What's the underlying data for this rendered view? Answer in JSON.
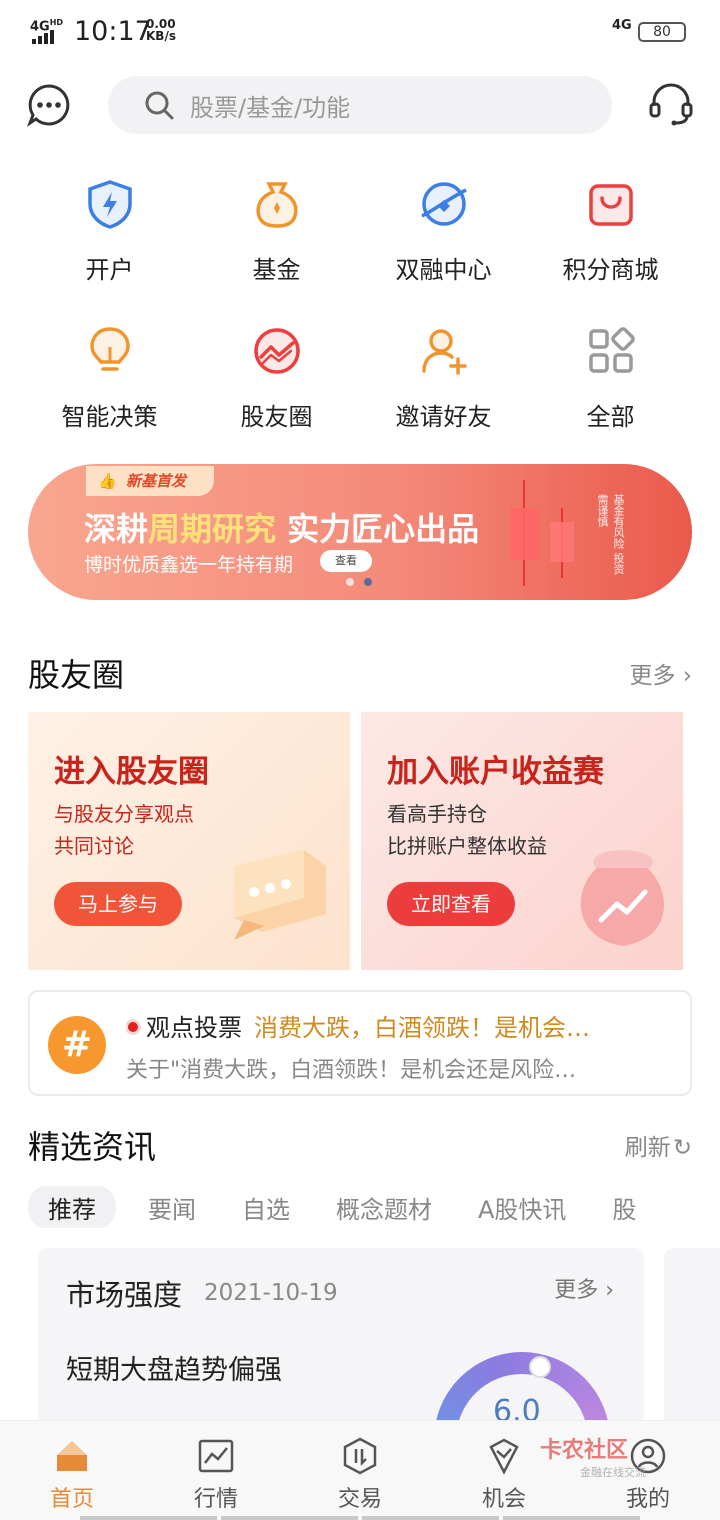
{
  "status_bar": {
    "network": "4G",
    "network_sup": "HD",
    "time": "10:17",
    "speed_value": "0.00",
    "speed_unit": "KB/s",
    "net_right": "4G",
    "battery": "80"
  },
  "top_bar": {
    "search_placeholder": "股票/基金/功能",
    "icons": [
      "message-icon",
      "search-icon",
      "headset-icon"
    ]
  },
  "quick_grid": [
    {
      "label": "开户",
      "icon": "shield-bolt-icon",
      "color": "#3b7fe6"
    },
    {
      "label": "基金",
      "icon": "money-bag-icon",
      "color": "#f0952e"
    },
    {
      "label": "双融中心",
      "icon": "planet-icon",
      "color": "#3b7fe6"
    },
    {
      "label": "积分商城",
      "icon": "shopping-bag-icon",
      "color": "#ec4040"
    },
    {
      "label": "智能决策",
      "icon": "lightbulb-icon",
      "color": "#f0952e"
    },
    {
      "label": "股友圈",
      "icon": "circle-chart-icon",
      "color": "#ec4040"
    },
    {
      "label": "邀请好友",
      "icon": "add-user-icon",
      "color": "#f0952e"
    },
    {
      "label": "全部",
      "icon": "grid-icon",
      "color": "#999999"
    }
  ],
  "banner": {
    "tag": "新基首发",
    "headline_a": "深耕",
    "headline_hl": "周期研究",
    "headline_b": " 实力匠心出品",
    "subtitle": "博时优质鑫选一年持有期",
    "button": "查看",
    "risk_note": "基金有风险 投资需谨慎"
  },
  "stock_circle": {
    "title": "股友圈",
    "more": "更多 ›",
    "cards": [
      {
        "title": "进入股友圈",
        "desc1": "与股友分享观点",
        "desc2": "共同讨论",
        "button": "马上参与"
      },
      {
        "title": "加入账户收益赛",
        "desc1": "看高手持仓",
        "desc2": "比拼账户整体收益",
        "button": "立即查看"
      }
    ]
  },
  "vote": {
    "badge": "#",
    "label": "观点投票",
    "topic": "消费大跌，白酒领跌！是机会…",
    "summary": "关于\"消费大跌，白酒领跌！是机会还是风险…"
  },
  "news": {
    "title": "精选资讯",
    "refresh": "刷新",
    "tabs": [
      "推荐",
      "要闻",
      "自选",
      "概念题材",
      "A股快讯",
      "股"
    ],
    "active_tab": 0
  },
  "market_card": {
    "title": "市场强度",
    "date": "2021-10-19",
    "more": "更多 ›",
    "statement": "短期大盘趋势偏强",
    "gauge_value": "6.0"
  },
  "bottom_nav": [
    {
      "label": "首页",
      "icon": "home-icon",
      "active": true
    },
    {
      "label": "行情",
      "icon": "chart-icon",
      "active": false
    },
    {
      "label": "交易",
      "icon": "trade-icon",
      "active": false
    },
    {
      "label": "机会",
      "icon": "opportunity-icon",
      "active": false
    },
    {
      "label": "我的",
      "icon": "profile-icon",
      "active": false
    }
  ],
  "watermark": {
    "text": "卡农社区",
    "sub": "金融在线交流"
  },
  "colors": {
    "accent": "#e58a38",
    "red": "#c8241b",
    "blue": "#3b7fe6"
  }
}
